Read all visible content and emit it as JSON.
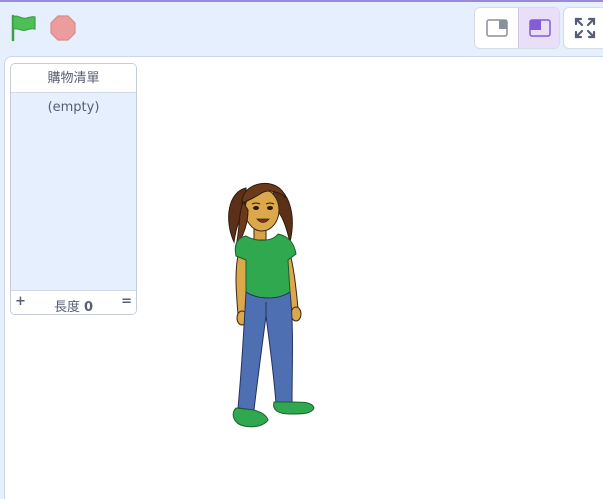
{
  "controls": {
    "green_flag_icon": "green-flag-icon",
    "stop_icon": "stop-sign-icon",
    "small_stage_icon": "small-stage-icon",
    "normal_stage_icon": "normal-stage-icon",
    "fullscreen_icon": "fullscreen-icon"
  },
  "list_monitor": {
    "title": "購物清單",
    "empty_text": "(empty)",
    "add_label": "+",
    "length_label": "長度",
    "length_value": "0",
    "resize_label": "="
  },
  "colors": {
    "accent": "#855cd6",
    "flag_green": "#4cbf56",
    "stop_red": "#ec9c9c",
    "stage_bg_outer": "#e6effd"
  }
}
